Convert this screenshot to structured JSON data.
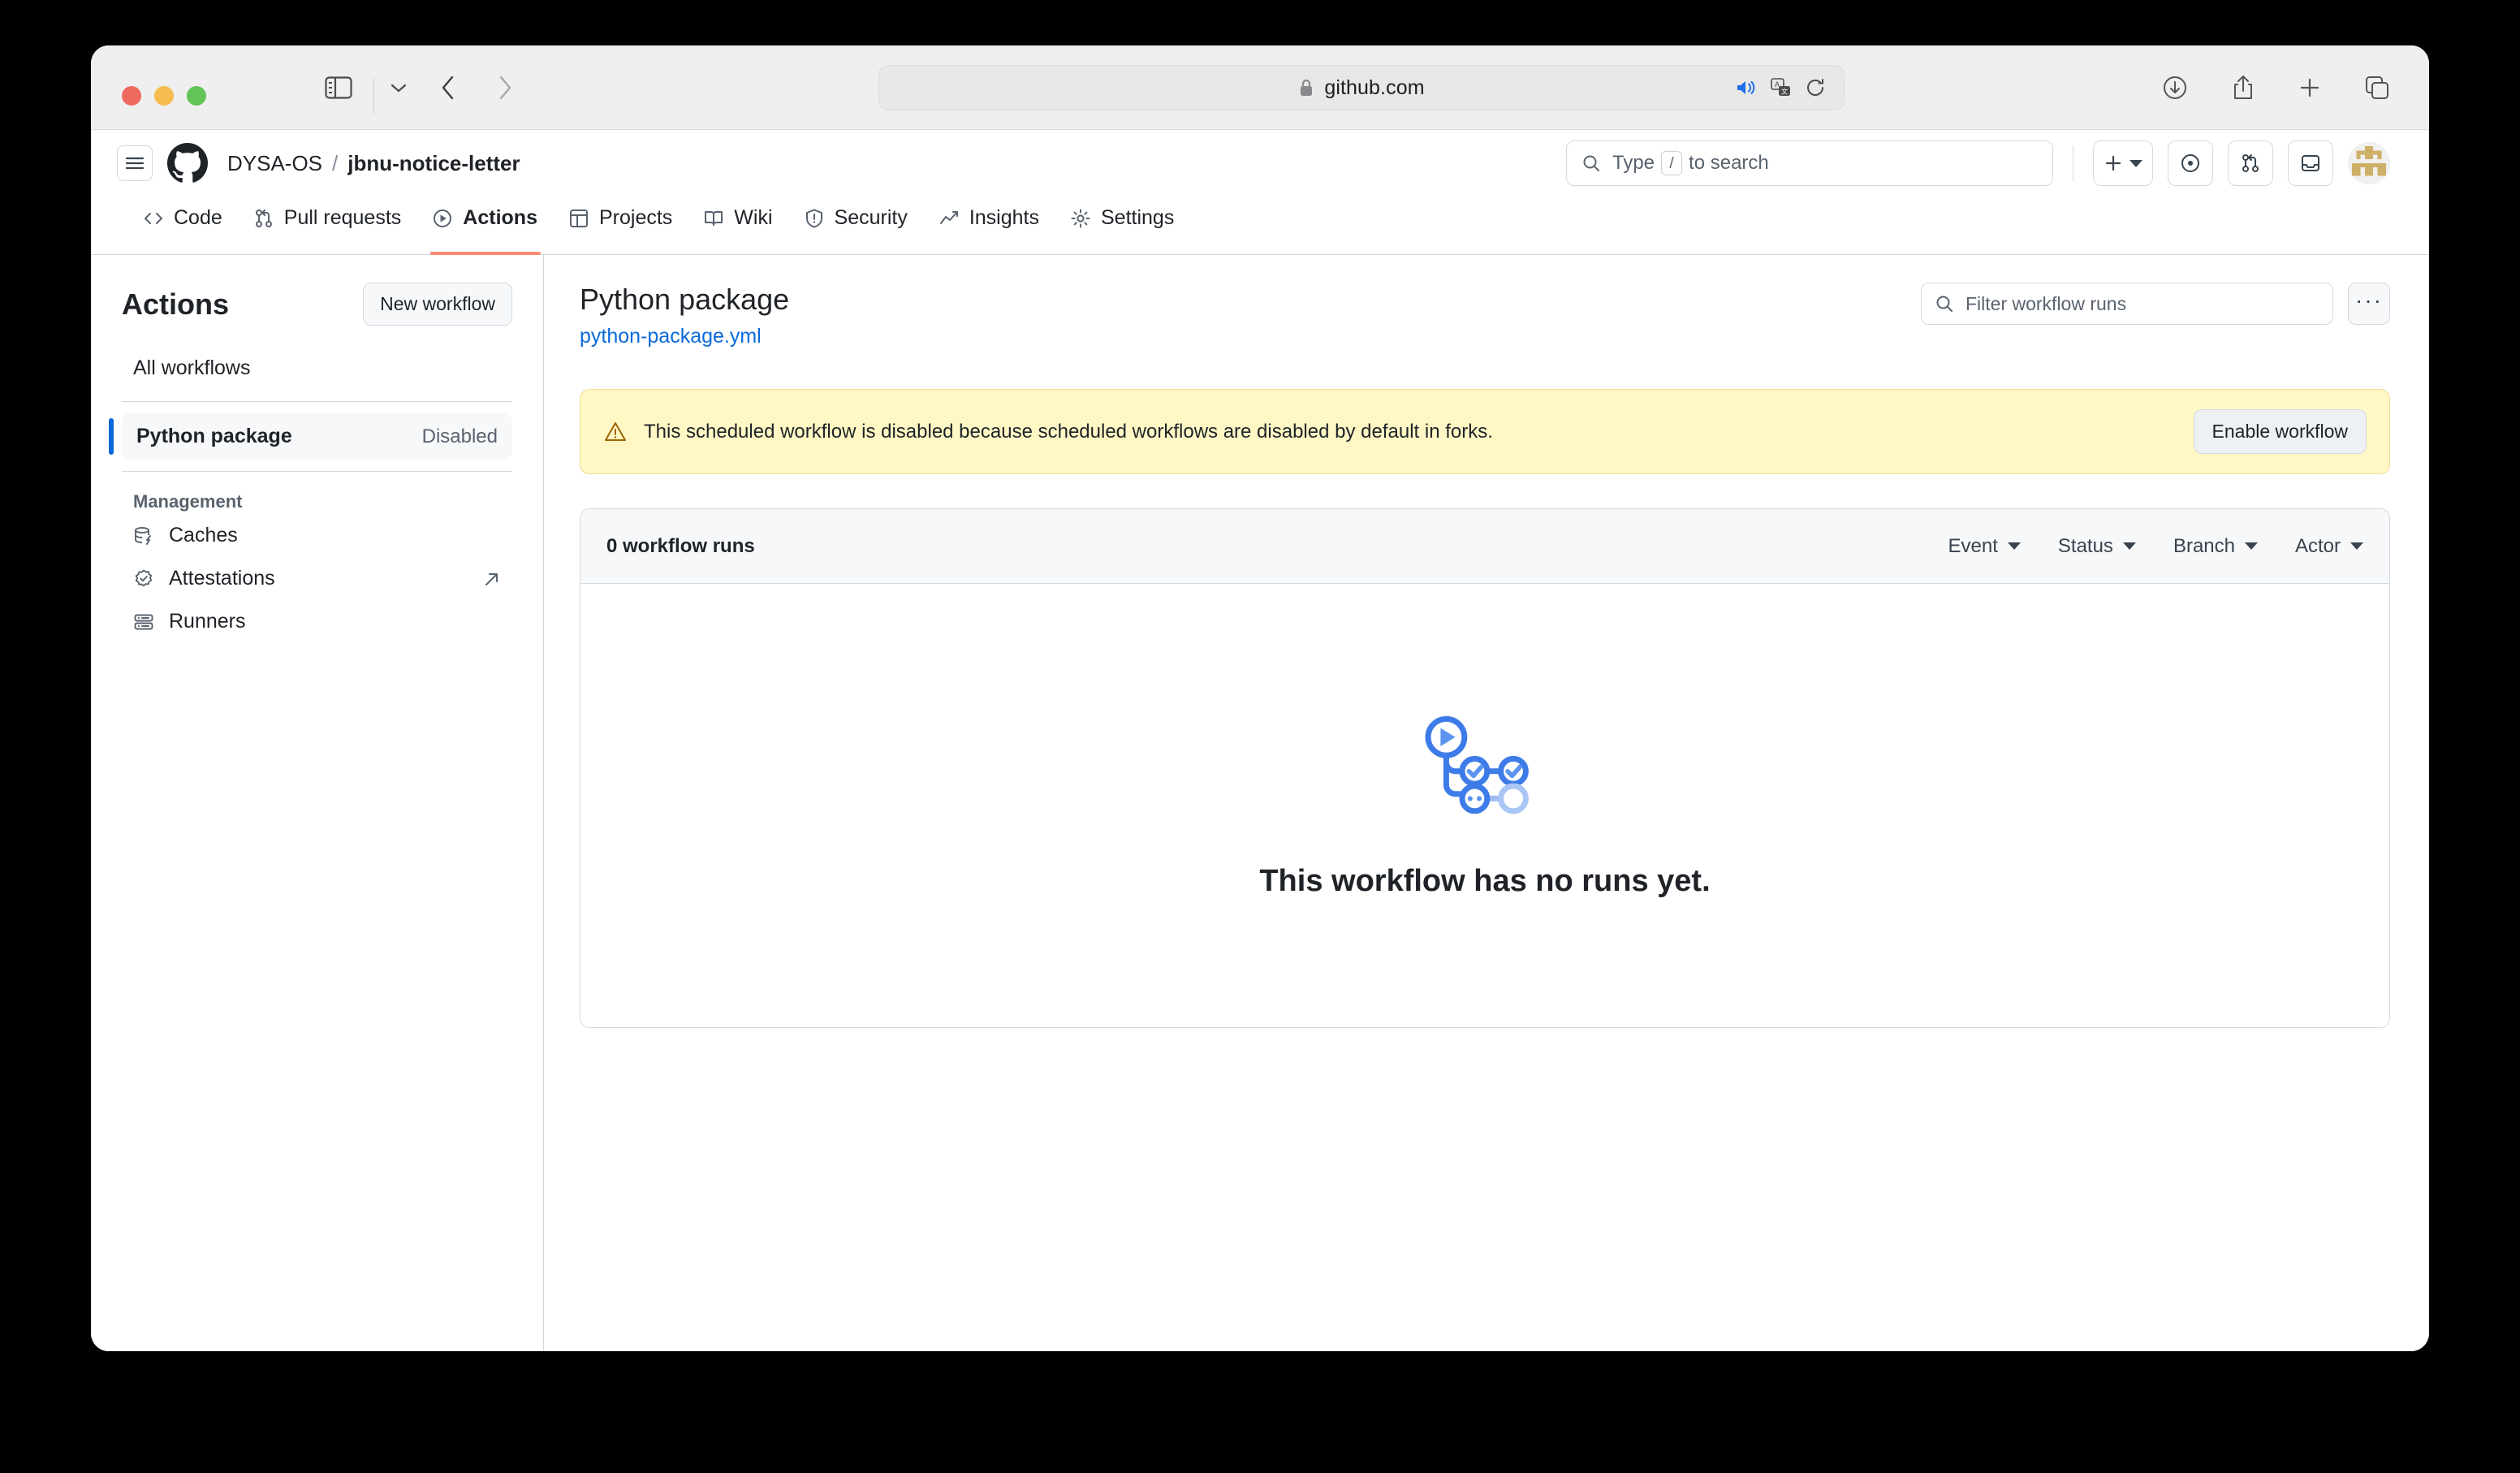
{
  "browser": {
    "url": "github.com",
    "lock_icon": "lock-icon",
    "audio_icon": "speaker-icon",
    "translate_icon": "translate-icon",
    "reload_icon": "reload-icon",
    "sidebar_icon": "sidebar-icon",
    "back_icon": "chevron-left-icon",
    "forward_icon": "chevron-right-icon",
    "downloads_icon": "download-icon",
    "share_icon": "share-icon",
    "new_tab_icon": "plus-icon",
    "tabs_icon": "tab-overview-icon"
  },
  "gh_header": {
    "hamburger_icon": "hamburger-icon",
    "logo_icon": "github-logo-icon",
    "owner": "DYSA-OS",
    "separator": "/",
    "repo": "jbnu-notice-letter",
    "search_placeholder_prefix": "Type",
    "search_key": "/",
    "search_placeholder_suffix": "to search",
    "create_icon": "plus-icon",
    "issues_icon": "issue-opened-icon",
    "pulls_icon": "git-pull-request-icon",
    "inbox_icon": "inbox-icon",
    "avatar": "user-avatar"
  },
  "repo_nav": {
    "tabs": [
      {
        "label": "Code",
        "icon": "code-icon",
        "active": false
      },
      {
        "label": "Pull requests",
        "icon": "git-pull-request-icon",
        "active": false
      },
      {
        "label": "Actions",
        "icon": "play-circle-icon",
        "active": true
      },
      {
        "label": "Projects",
        "icon": "table-icon",
        "active": false
      },
      {
        "label": "Wiki",
        "icon": "book-icon",
        "active": false
      },
      {
        "label": "Security",
        "icon": "shield-icon",
        "active": false
      },
      {
        "label": "Insights",
        "icon": "graph-icon",
        "active": false
      },
      {
        "label": "Settings",
        "icon": "gear-icon",
        "active": false
      }
    ],
    "active_underline_color": "#fd8c73"
  },
  "sidebar": {
    "title": "Actions",
    "new_workflow_label": "New workflow",
    "all_workflows_label": "All workflows",
    "workflow": {
      "label": "Python package",
      "status": "Disabled",
      "indicator_color": "#0969da"
    },
    "management_heading": "Management",
    "management_items": [
      {
        "label": "Caches",
        "icon": "database-cache-icon",
        "external": false
      },
      {
        "label": "Attestations",
        "icon": "verified-badge-icon",
        "external": true
      },
      {
        "label": "Runners",
        "icon": "server-icon",
        "external": false
      }
    ]
  },
  "main": {
    "workflow_title": "Python package",
    "workflow_file": "python-package.yml",
    "filter_placeholder": "Filter workflow runs",
    "search_icon": "search-icon",
    "kebab_label": "···",
    "banner": {
      "icon": "alert-triangle-icon",
      "text": "This scheduled workflow is disabled because scheduled workflows are disabled by default in forks.",
      "button_label": "Enable workflow",
      "background": "#fff8c5"
    },
    "runs": {
      "count_label": "0 workflow runs",
      "filters": [
        {
          "label": "Event"
        },
        {
          "label": "Status"
        },
        {
          "label": "Branch"
        },
        {
          "label": "Actor"
        }
      ],
      "empty_illustration": "actions-workflow-graph-illustration",
      "empty_title": "This workflow has no runs yet."
    }
  }
}
